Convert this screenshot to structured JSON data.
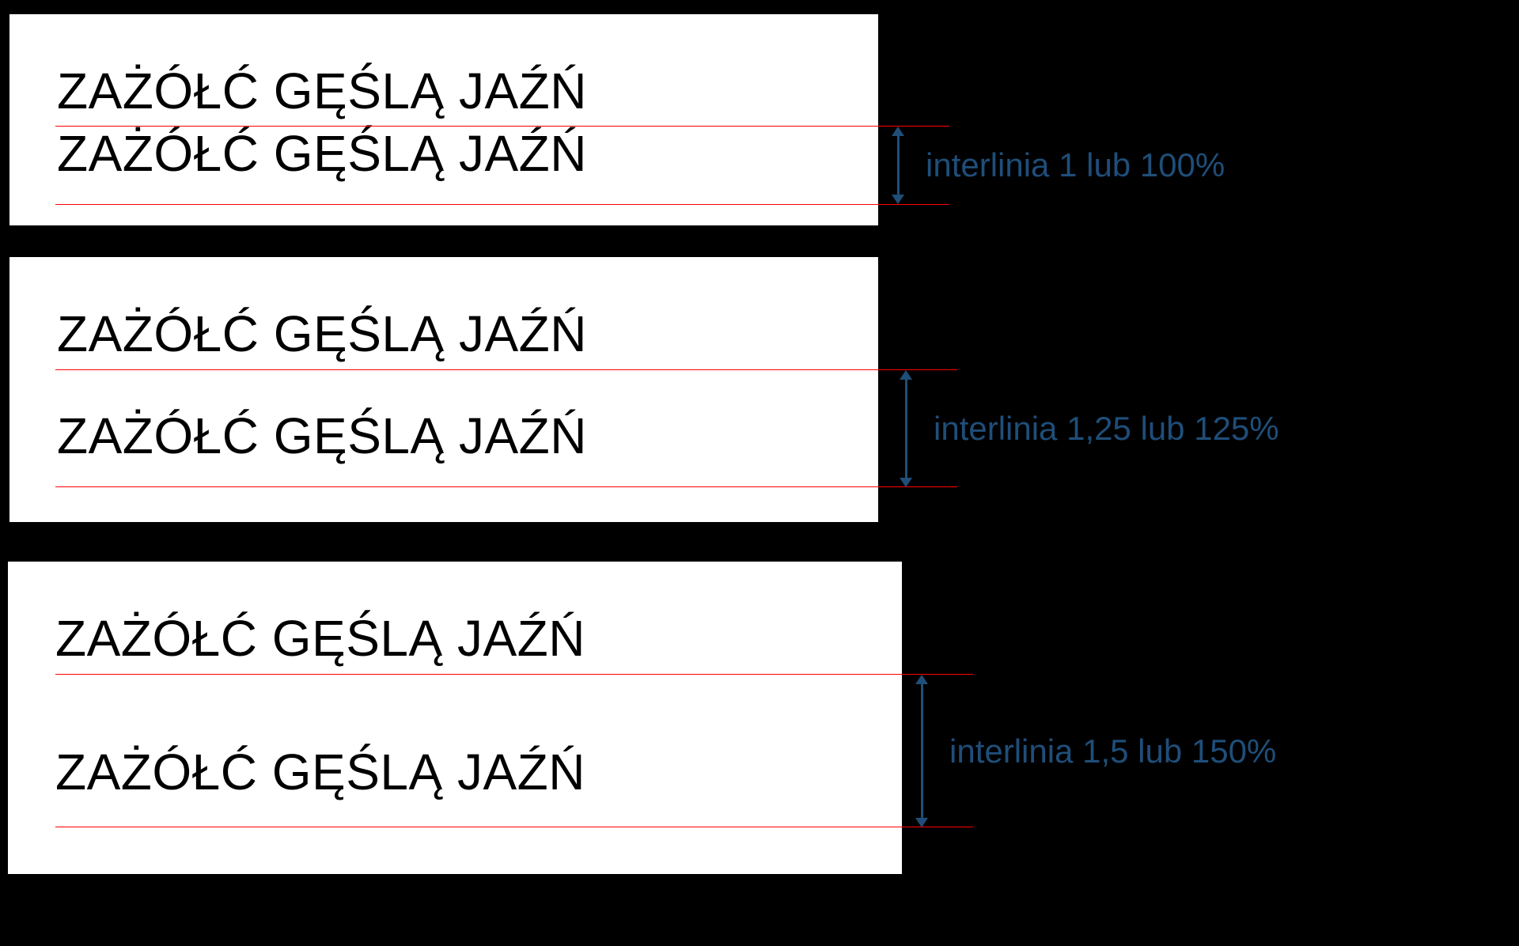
{
  "sample_text": "ZAŻÓŁĆ GĘŚLĄ JAŹŃ",
  "annotations": [
    {
      "label": "interlinia 1 lub 100%"
    },
    {
      "label": "interlinia 1,25 lub 125%"
    },
    {
      "label": "interlinia 1,5 lub 150%"
    }
  ],
  "colors": {
    "guide": "#ff0000",
    "annotation": "#1f4e79",
    "background": "#000000",
    "panel": "#ffffff"
  }
}
